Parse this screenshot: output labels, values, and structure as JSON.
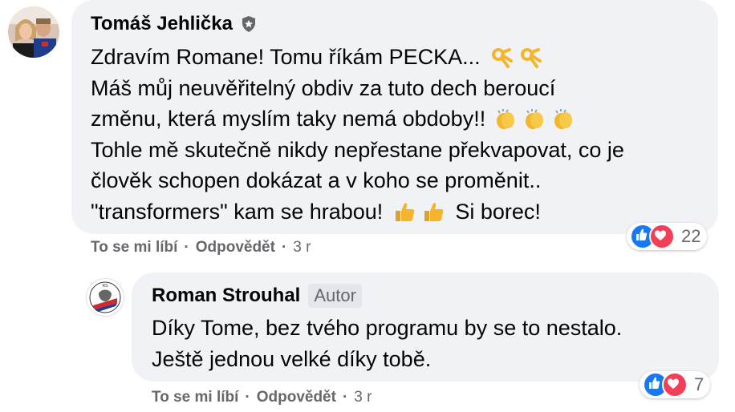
{
  "comment": {
    "author": "Tomáš Jehlička",
    "lines": [
      {
        "text": "Zdravím Romane! Tomu říkám PECKA...",
        "emoji": [
          "ok-hand",
          "ok-hand"
        ]
      },
      {
        "text": "Máš můj neuvěřitelný obdiv za tuto dech beroucí",
        "emoji": []
      },
      {
        "text": "změnu, která myslím taky nemá obdoby!!",
        "emoji": [
          "clapping-hands",
          "clapping-hands",
          "clapping-hands"
        ]
      },
      {
        "text": "Tohle mě skutečně nikdy nepřestane překvapovat, co je",
        "emoji": []
      },
      {
        "text": "člověk schopen dokázat a v koho se proměnit..",
        "emoji": []
      },
      {
        "text": "\"transformers\" kam se hrabou!",
        "emoji": [
          "thumbs-up",
          "thumbs-up"
        ],
        "suffix": "Si borec!"
      }
    ],
    "like_label": "To se mi líbí",
    "reply_label": "Odpovědět",
    "time": "3 r",
    "reaction_count": "22"
  },
  "reply": {
    "author": "Roman Strouhal",
    "author_badge": "Autor",
    "lines": [
      {
        "text": "Díky Tome, bez tvého programu by se to nestalo."
      },
      {
        "text": "Ještě jednou velké díky tobě."
      }
    ],
    "like_label": "To se mi líbí",
    "reply_label": "Odpovědět",
    "time": "3 r",
    "reaction_count": "7"
  },
  "colors": {
    "bubble": "#f0f2f5",
    "like": "#1877f2",
    "love": "#f33e58",
    "meta_text": "#65676b"
  }
}
